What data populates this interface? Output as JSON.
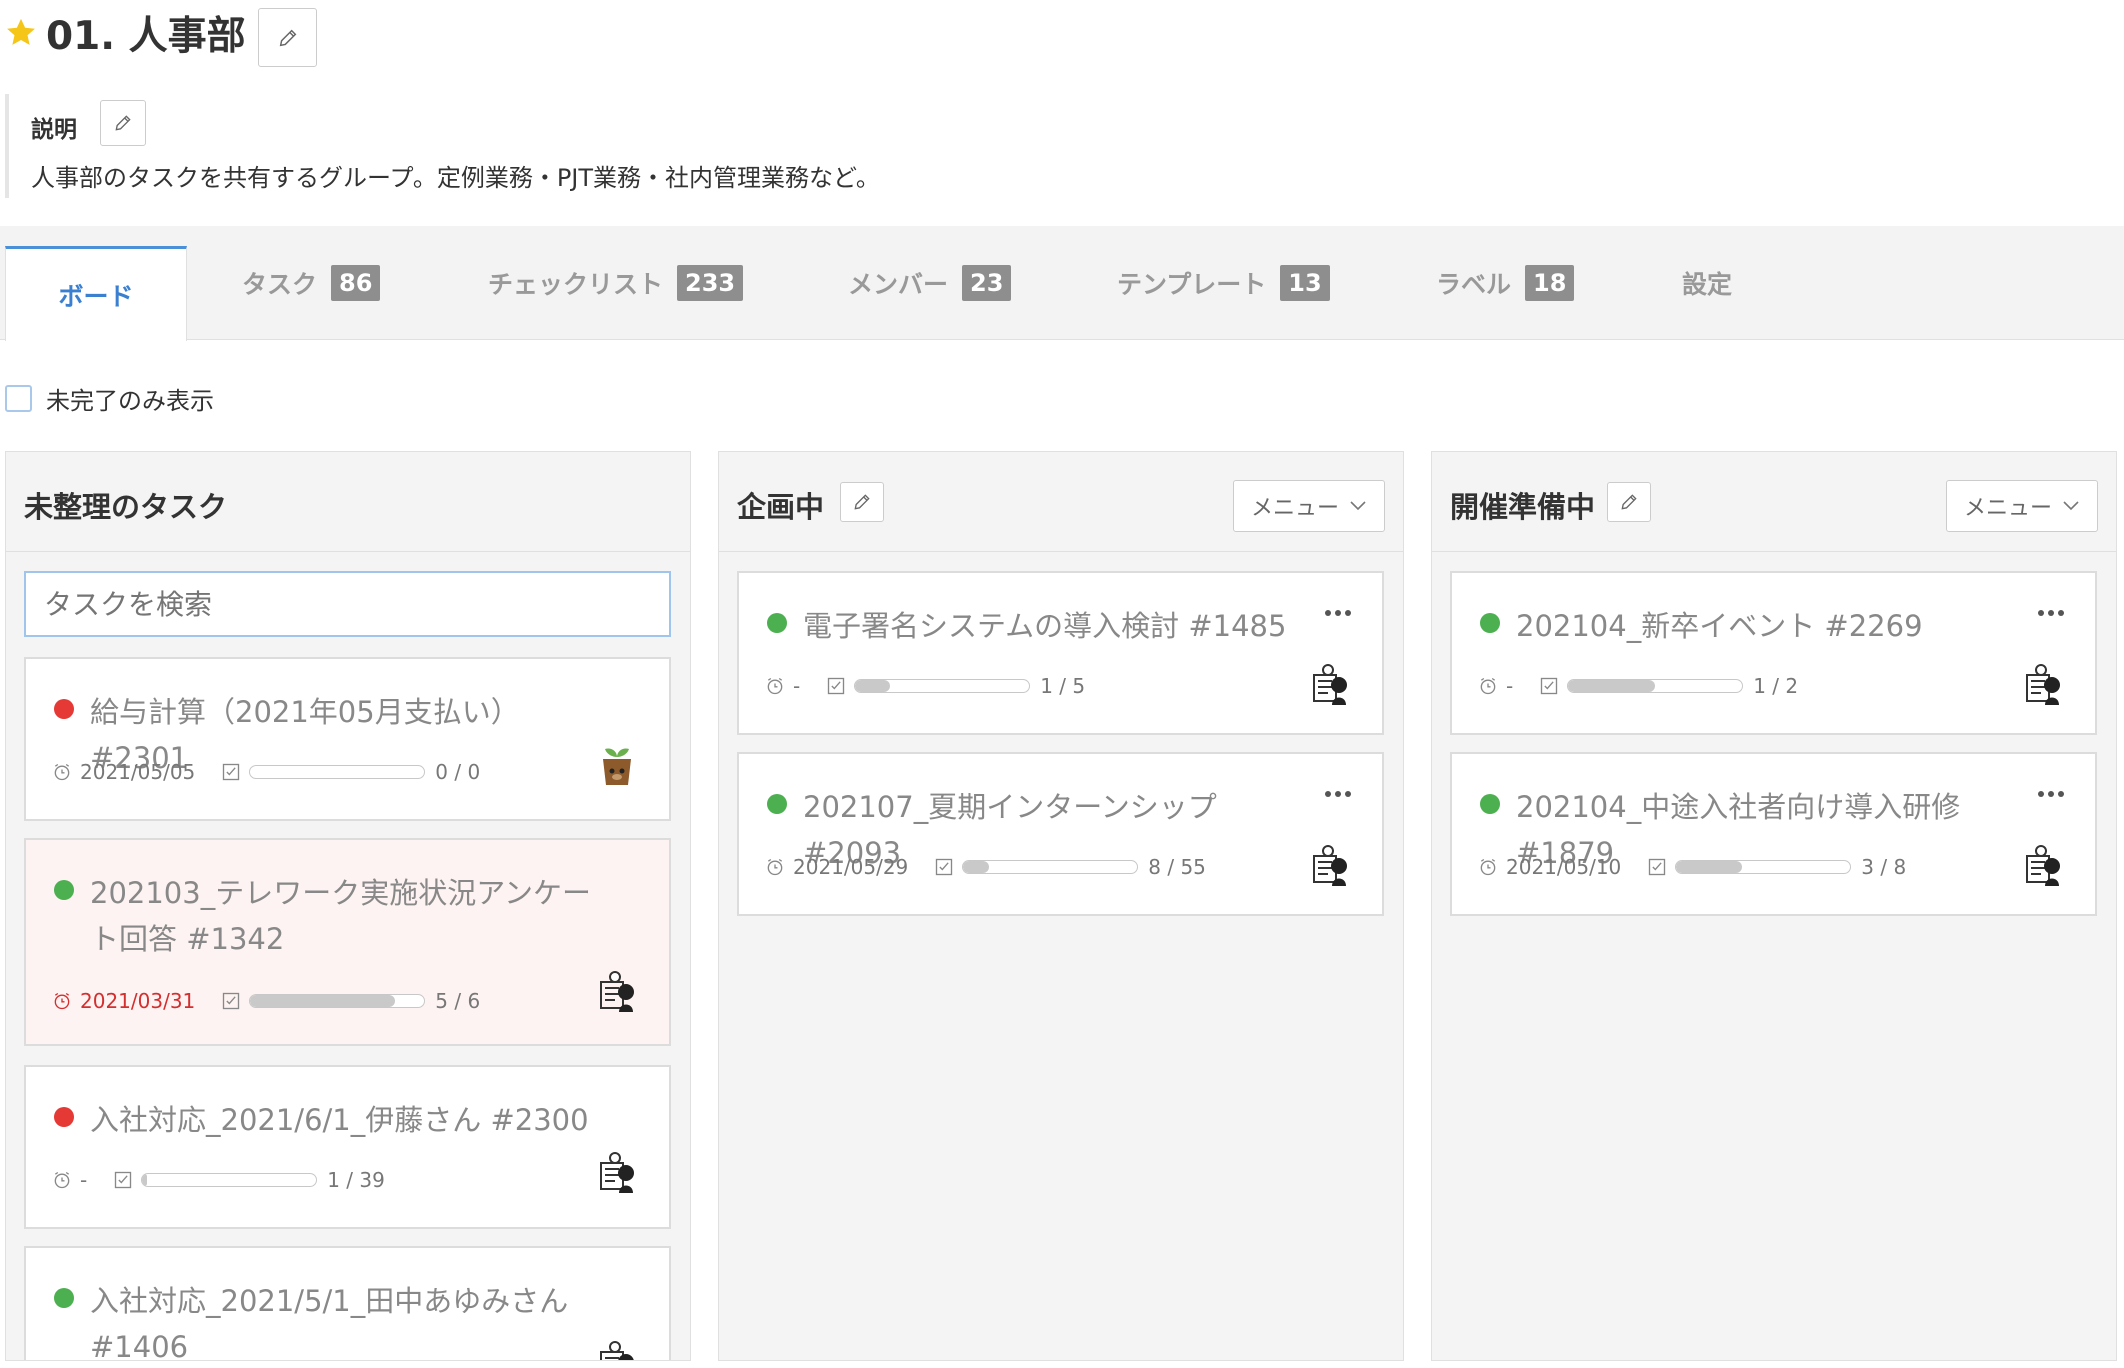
{
  "header": {
    "title": "01. 人事部",
    "description_label": "説明",
    "description": "人事部のタスクを共有するグループ。定例業務・PJT業務・社内管理業務など。"
  },
  "tabs": [
    {
      "label": "ボード",
      "badge": null,
      "active": true
    },
    {
      "label": "タスク",
      "badge": "86"
    },
    {
      "label": "チェックリスト",
      "badge": "233"
    },
    {
      "label": "メンバー",
      "badge": "23"
    },
    {
      "label": "テンプレート",
      "badge": "13"
    },
    {
      "label": "ラベル",
      "badge": "18"
    },
    {
      "label": "設定",
      "badge": null
    }
  ],
  "filter": {
    "label": "未完了のみ表示",
    "checked": false
  },
  "columns": [
    {
      "title": "未整理のタスク",
      "search_placeholder": "タスクを検索",
      "cards": [
        {
          "status": "red",
          "title": "給与計算（2021年05月支払い） #2301",
          "due": "2021/05/05",
          "progress": 0,
          "count": "0 / 0",
          "avatar": "seedling-avatar"
        },
        {
          "status": "green",
          "title": "202103_テレワーク実施状況アンケート回答 #1342",
          "due": "2021/03/31",
          "overdue": true,
          "progress": 0.83,
          "count": "5 / 6",
          "avatar": "group-avatar"
        },
        {
          "status": "red",
          "title": "入社対応_2021/6/1_伊藤さん #2300",
          "due": "-",
          "progress": 0.03,
          "count": "1 / 39",
          "avatar": "group-avatar"
        },
        {
          "status": "green",
          "title": "入社対応_2021/5/1_田中あゆみさん #1406",
          "due": "",
          "progress": 0,
          "count": "",
          "avatar": "group-avatar"
        }
      ]
    },
    {
      "title": "企画中",
      "menu_label": "メニュー",
      "cards": [
        {
          "status": "green",
          "title": "電子署名システムの導入検討 #1485",
          "due": "-",
          "progress": 0.2,
          "count": "1 / 5",
          "avatar": "group-avatar"
        },
        {
          "status": "green",
          "title": "202107_夏期インターンシップ #2093",
          "due": "2021/05/29",
          "progress": 0.15,
          "count": "8 / 55",
          "avatar": "group-avatar"
        }
      ]
    },
    {
      "title": "開催準備中",
      "menu_label": "メニュー",
      "cards": [
        {
          "status": "green",
          "title": "202104_新卒イベント #2269",
          "due": "-",
          "progress": 0.5,
          "count": "1 / 2",
          "avatar": "group-avatar"
        },
        {
          "status": "green",
          "title": "202104_中途入社者向け導入研修 #1879",
          "due": "2021/05/10",
          "progress": 0.375,
          "count": "3 / 8",
          "avatar": "group-avatar"
        }
      ]
    }
  ],
  "colors": {
    "accent": "#3a7fd0",
    "status_red": "#e53935",
    "status_green": "#4caf50",
    "overdue_text": "#d32f2f",
    "badge": "#8e8e8e"
  }
}
